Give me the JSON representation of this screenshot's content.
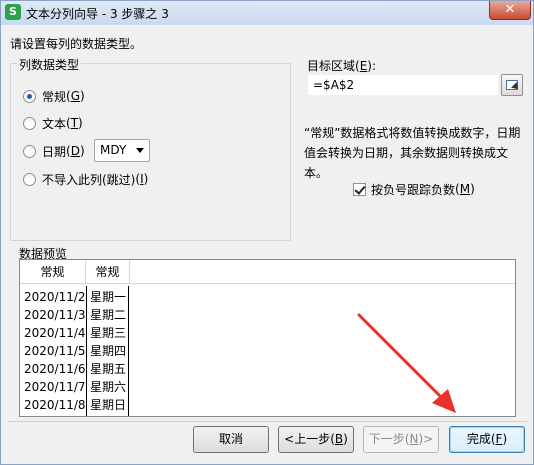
{
  "window": {
    "app_icon_letter": "S",
    "title": "文本分列向导 - 3 步骤之 3",
    "close_symbol": "✕"
  },
  "instruction": "请设置每列的数据类型。",
  "column_type": {
    "legend": "列数据类型",
    "options": [
      {
        "label": "常规",
        "key": "G",
        "checked": true
      },
      {
        "label": "文本",
        "key": "T",
        "checked": false
      },
      {
        "label": "日期",
        "key": "D",
        "checked": false
      },
      {
        "label": "不导入此列(跳过)",
        "key": "I",
        "checked": false
      }
    ],
    "date_format": "MDY"
  },
  "target": {
    "label": "目标区域",
    "key": "E",
    "value": "=$A$2"
  },
  "description": "“常规”数据格式将数值转换成数字，日期值会转换为日期，其余数据则转换成文本。",
  "negative_option": {
    "label": "按负号跟踪负数",
    "key": "M",
    "checked": true
  },
  "preview": {
    "label": "数据预览",
    "headers": [
      "常规",
      "常规"
    ],
    "rows": [
      [
        "2020/11/2",
        "星期一"
      ],
      [
        "2020/11/3",
        "星期二"
      ],
      [
        "2020/11/4",
        "星期三"
      ],
      [
        "2020/11/5",
        "星期四"
      ],
      [
        "2020/11/6",
        "星期五"
      ],
      [
        "2020/11/7",
        "星期六"
      ],
      [
        "2020/11/8",
        "星期日"
      ]
    ]
  },
  "buttons": {
    "cancel": "取消",
    "back": "<上一步",
    "back_key": "B",
    "next": "下一步",
    "next_key": "N",
    "finish": "完成",
    "finish_key": "F"
  },
  "colors": {
    "annotation_arrow": "#e8322a",
    "accent": "#3c7fb1"
  }
}
